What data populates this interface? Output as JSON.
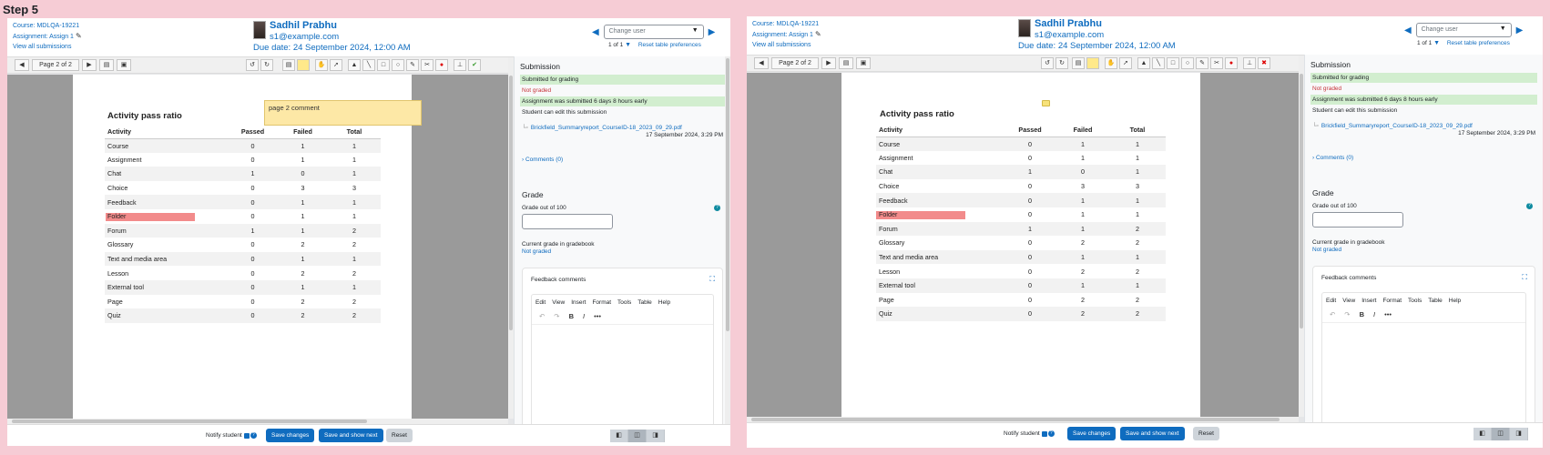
{
  "step_title": "Step 5",
  "header": {
    "course": "Course: MDLQA-19221",
    "assignment": "Assignment: Assign 1",
    "view_all": "View all submissions",
    "user_name": "Sadhil Prabhu",
    "user_email": "s1@example.com",
    "due_date": "Due date: 24 September 2024, 12:00 AM",
    "change_user_placeholder": "Change user",
    "count": "1 of 1",
    "reset_prefs": "Reset table preferences"
  },
  "toolbar": {
    "page_label": "Page 2 of 2"
  },
  "pdf": {
    "sticky_comment": "page 2 comment",
    "table_title": "Activity pass ratio",
    "columns": [
      "Activity",
      "Passed",
      "Failed",
      "Total"
    ],
    "rows": [
      {
        "activity": "Course",
        "passed": "0",
        "failed": "1",
        "total": "1"
      },
      {
        "activity": "Assignment",
        "passed": "0",
        "failed": "1",
        "total": "1"
      },
      {
        "activity": "Chat",
        "passed": "1",
        "failed": "0",
        "total": "1"
      },
      {
        "activity": "Choice",
        "passed": "0",
        "failed": "3",
        "total": "3"
      },
      {
        "activity": "Feedback",
        "passed": "0",
        "failed": "1",
        "total": "1"
      },
      {
        "activity": "Folder",
        "passed": "0",
        "failed": "1",
        "total": "1"
      },
      {
        "activity": "Forum",
        "passed": "1",
        "failed": "1",
        "total": "2"
      },
      {
        "activity": "Glossary",
        "passed": "0",
        "failed": "2",
        "total": "2"
      },
      {
        "activity": "Text and media area",
        "passed": "0",
        "failed": "1",
        "total": "1"
      },
      {
        "activity": "Lesson",
        "passed": "0",
        "failed": "2",
        "total": "2"
      },
      {
        "activity": "External tool",
        "passed": "0",
        "failed": "1",
        "total": "1"
      },
      {
        "activity": "Page",
        "passed": "0",
        "failed": "2",
        "total": "2"
      },
      {
        "activity": "Quiz",
        "passed": "0",
        "failed": "2",
        "total": "2"
      }
    ]
  },
  "side": {
    "submission_title": "Submission",
    "submitted": "Submitted for grading",
    "not_graded": "Not graded",
    "early": "Assignment was submitted 6 days 8 hours early",
    "can_edit": "Student can edit this submission",
    "file_name": "Brickfield_Summaryreport_CourseID-18_2023_09_29.pdf",
    "file_date": "17 September 2024, 3:29 PM",
    "comments": "Comments (0)",
    "grade_title": "Grade",
    "grade_out_of": "Grade out of 100",
    "current_grade_label": "Current grade in gradebook",
    "current_grade_value": "Not graded",
    "feedback_title": "Feedback comments",
    "menu": [
      "Edit",
      "View",
      "Insert",
      "Format",
      "Tools",
      "Table",
      "Help"
    ]
  },
  "footer": {
    "notify": "Notify student",
    "save": "Save changes",
    "save_next": "Save and show next",
    "reset": "Reset"
  },
  "colors": {
    "accent": "#0f6cbf",
    "background": "#f6ccd5",
    "annotation_red": "#ed6464",
    "sticky_yellow": "#fde8a6"
  }
}
